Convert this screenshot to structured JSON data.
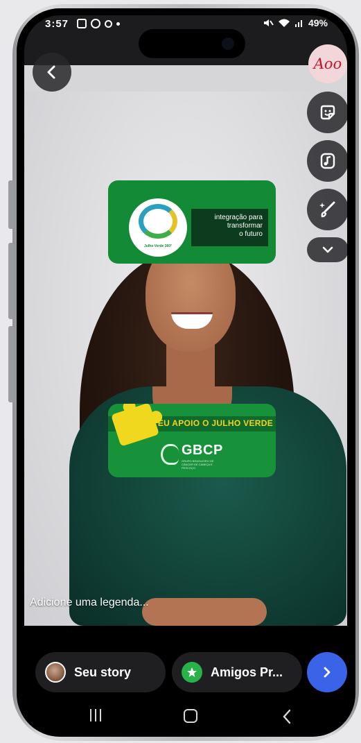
{
  "status_bar": {
    "time": "3:57",
    "battery": "49%"
  },
  "header": {
    "avatar_text": "Aoo"
  },
  "stickers": {
    "top": {
      "logo_caption": "Julho Verde 360°",
      "tagline_line1": "integração para",
      "tagline_line2": "transformar",
      "tagline_line3": "o futuro"
    },
    "bottom": {
      "support_text": "EU APOIO O JULHO VERDE",
      "brand": "GBCP",
      "brand_subtitle": "GRUPO BRASILEIRO DE CÂNCER DE CABEÇA E PESCOÇO"
    }
  },
  "caption": {
    "placeholder": "Adicione uma legenda..."
  },
  "share_bar": {
    "your_story_label": "Seu story",
    "close_friends_label": "Amigos Pr..."
  },
  "colors": {
    "accent_blue": "#3a63e8",
    "sticker_green": "#138a36",
    "close_friends_green": "#27b24a"
  },
  "icons": {
    "back": "chevron-left-icon",
    "sticker": "sticker-icon",
    "music": "music-note-icon",
    "draw": "brush-sparkle-icon",
    "more": "chevron-down-icon",
    "next": "chevron-right-icon"
  }
}
